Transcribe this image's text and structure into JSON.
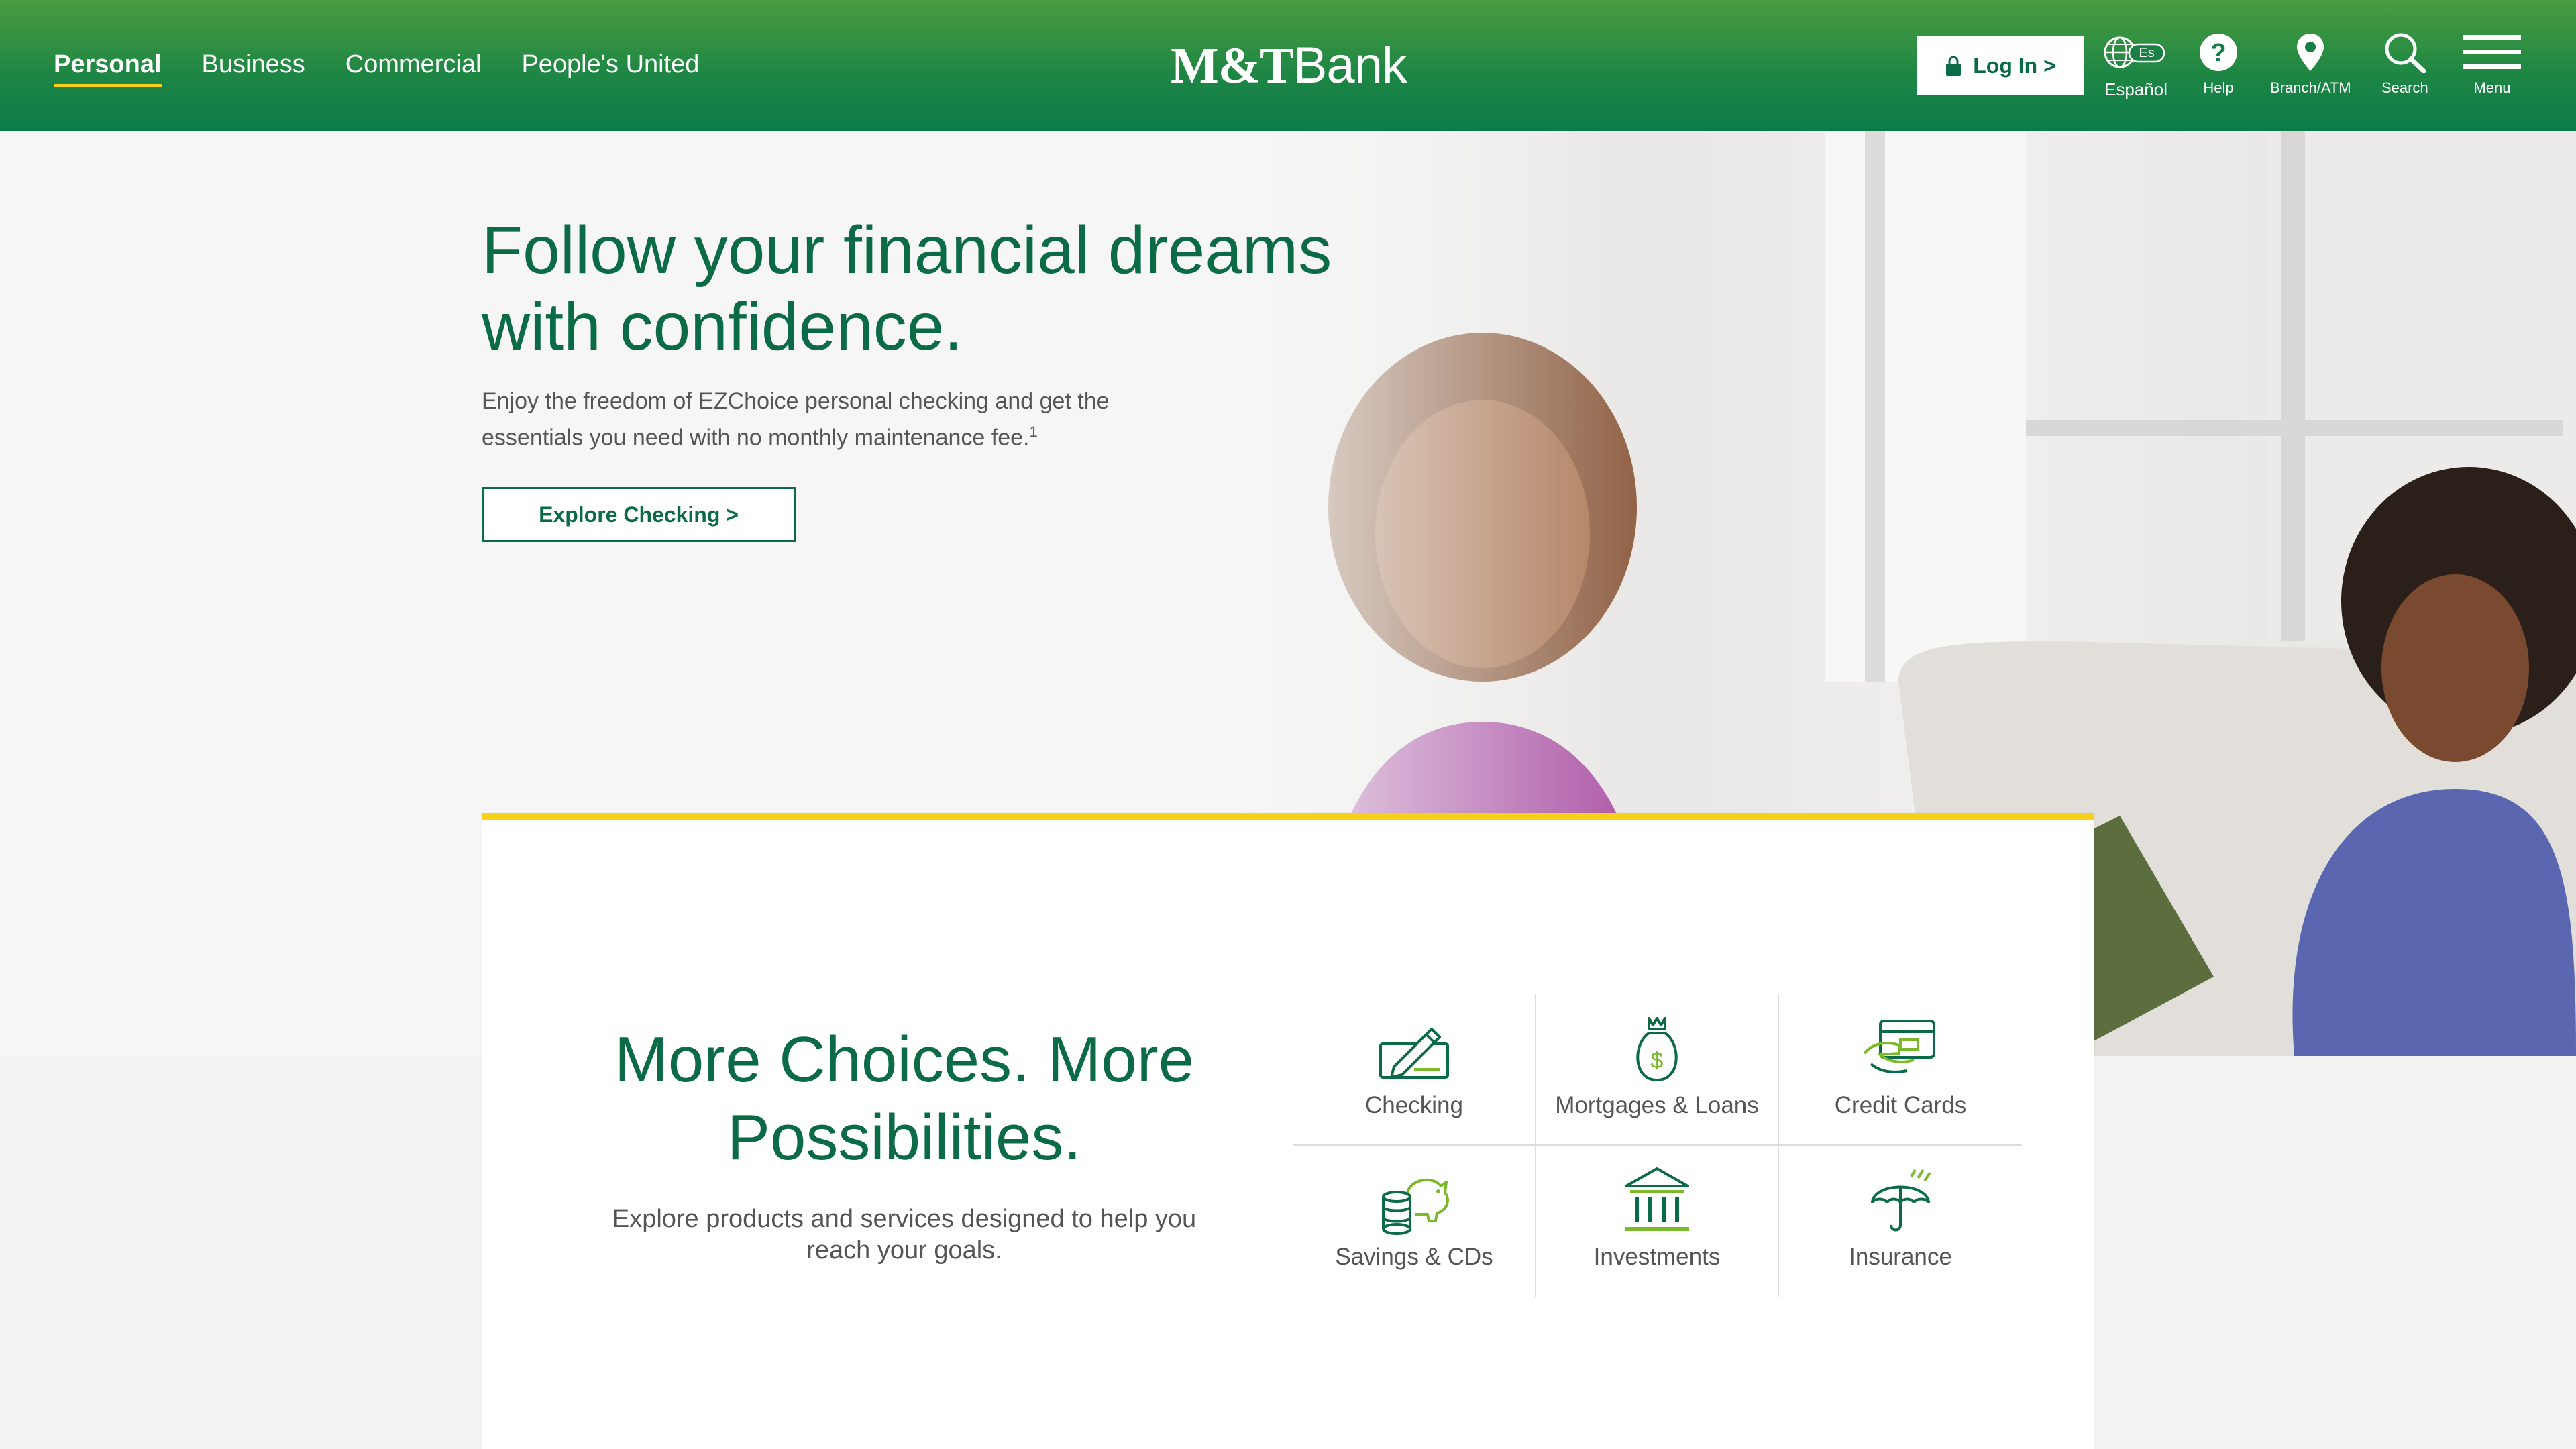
{
  "header": {
    "nav": [
      "Personal",
      "Business",
      "Commercial",
      "People's United"
    ],
    "logo": {
      "brand": "M&T",
      "suffix": "Bank"
    },
    "login_label": "Log In >",
    "utilities": {
      "espanol": {
        "badge": "Es",
        "label": "Español"
      },
      "help": "Help",
      "branch": "Branch/ATM",
      "search": "Search",
      "menu": "Menu"
    }
  },
  "hero": {
    "title": "Follow your financial dreams with confidence.",
    "subtitle": "Enjoy the freedom of EZChoice personal checking and get the essentials you need with no monthly maintenance fee.",
    "footnote": "1",
    "cta": "Explore Checking >"
  },
  "products": {
    "title": "More Choices. More Possibilities.",
    "subtitle": "Explore products and services designed to help you reach your goals.",
    "items": [
      {
        "label": "Checking",
        "icon": "checkbook-icon"
      },
      {
        "label": "Mortgages & Loans",
        "icon": "money-bag-icon"
      },
      {
        "label": "Credit Cards",
        "icon": "credit-card-hand-icon"
      },
      {
        "label": "Savings & CDs",
        "icon": "piggy-bank-icon"
      },
      {
        "label": "Investments",
        "icon": "bank-building-icon"
      },
      {
        "label": "Insurance",
        "icon": "umbrella-icon"
      }
    ]
  },
  "colors": {
    "brand_green": "#0c6b47",
    "header_top": "#4a9c3f",
    "accent_yellow": "#f7d117",
    "icon_lime": "#7ab929"
  }
}
